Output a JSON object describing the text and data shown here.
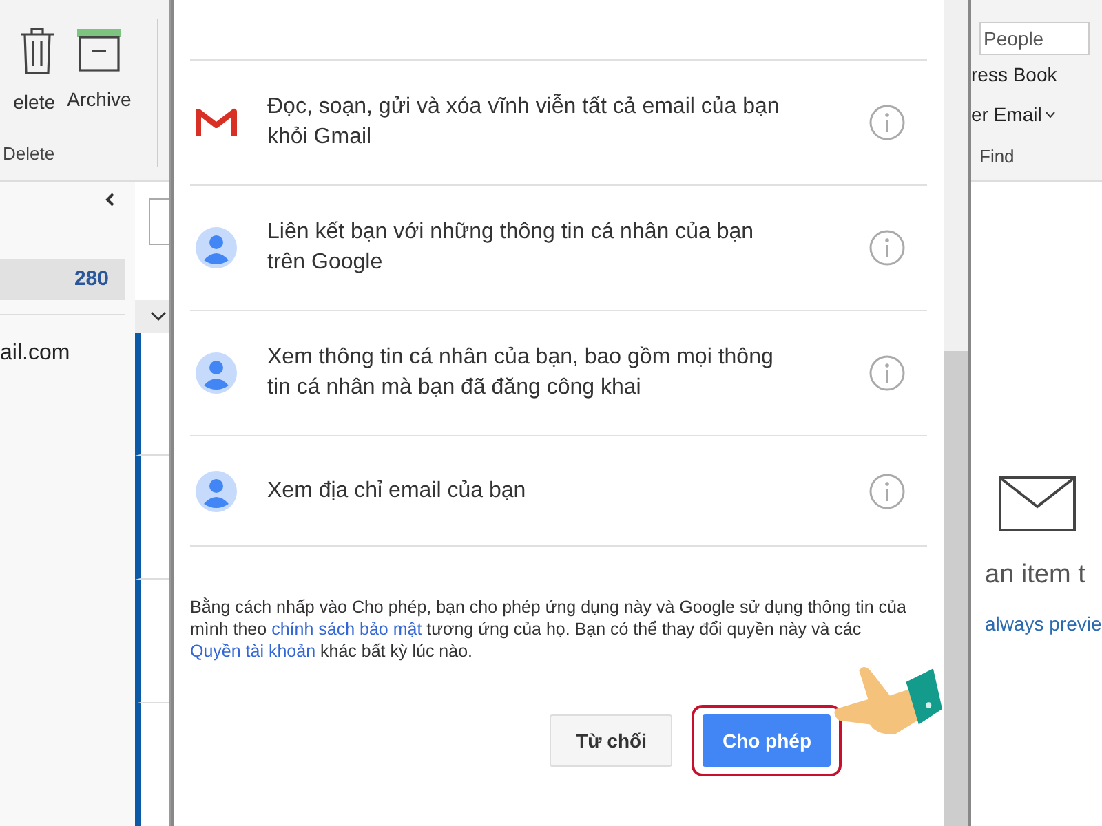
{
  "left_ribbon": {
    "buttons": [
      {
        "kind": "trash",
        "label": "elete"
      },
      {
        "kind": "archive",
        "label": "Archive"
      }
    ],
    "group_label": "Delete"
  },
  "folder_pane": {
    "folder": {
      "count": "280",
      "selected": true
    },
    "account": "ail.com"
  },
  "dialog": {
    "permissions": [
      {
        "kind": "gmail",
        "text": "Đọc, soạn, gửi và xóa vĩnh viễn tất cả email của bạn khỏi Gmail"
      },
      {
        "kind": "person",
        "text": "Liên kết bạn với những thông tin cá nhân của bạn trên Google"
      },
      {
        "kind": "person",
        "text": "Xem thông tin cá nhân của bạn, bao gồm mọi thông tin cá nhân mà bạn đã đăng công khai"
      },
      {
        "kind": "person",
        "text": "Xem địa chỉ email của bạn"
      }
    ],
    "notice": [
      {
        "kind": "text",
        "text": "Bằng cách nhấp vào Cho phép, bạn cho phép ứng dụng này và Google sử dụng thông tin của mình theo "
      },
      {
        "kind": "link",
        "text": "chính sách bảo mật"
      },
      {
        "kind": "text",
        "text": " tương ứng của họ. Bạn có thể thay đổi quyền này và các "
      },
      {
        "kind": "link",
        "text": "Quyền tài khoản"
      },
      {
        "kind": "text",
        "text": " khác bất kỳ lúc nào."
      }
    ],
    "buttons": [
      {
        "label": "Từ chối",
        "kind": "secondary",
        "highlighted": false
      },
      {
        "label": "Cho phép",
        "kind": "primary",
        "highlighted": true
      }
    ]
  },
  "right_ribbon": {
    "search_placeholder": "People",
    "items": [
      "ress Book",
      "er Email"
    ],
    "group_label": "Find"
  },
  "reading_pane": {
    "message": "an item t",
    "link": "always previe"
  }
}
